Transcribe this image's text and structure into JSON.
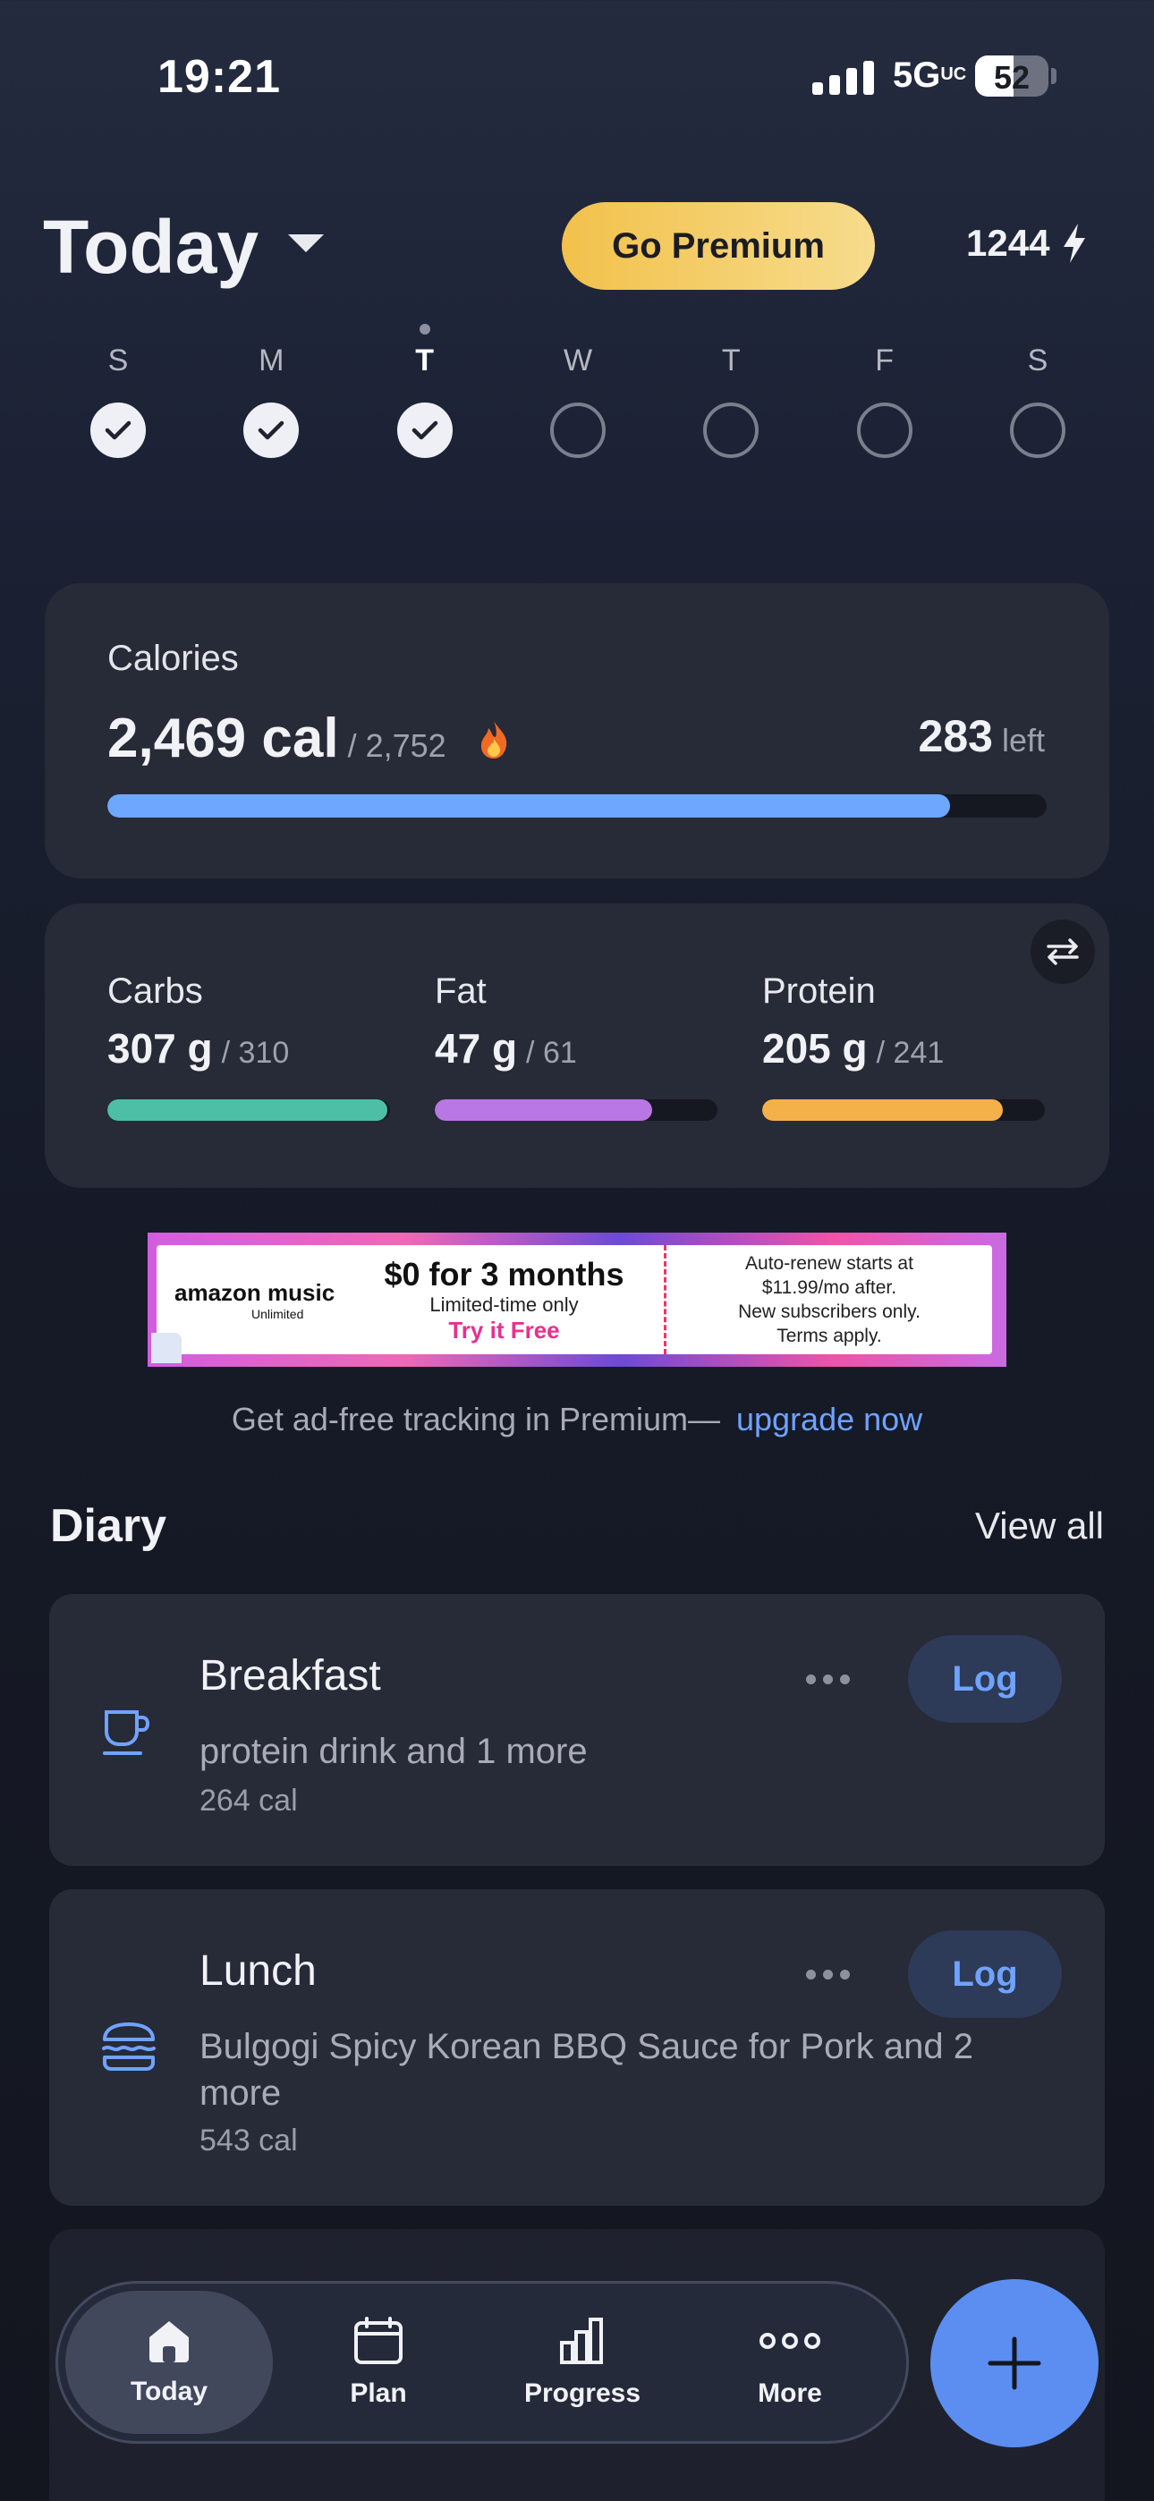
{
  "status_bar": {
    "time": "19:21",
    "network": "5G",
    "network_suffix": "UC",
    "battery": "52",
    "battery_level": 0.52
  },
  "header": {
    "title": "Today",
    "premium_label": "Go Premium",
    "streak_count": "1244"
  },
  "week": [
    {
      "label": "S",
      "done": true,
      "today": false
    },
    {
      "label": "M",
      "done": true,
      "today": false
    },
    {
      "label": "T",
      "done": true,
      "today": true
    },
    {
      "label": "W",
      "done": false,
      "today": false
    },
    {
      "label": "T",
      "done": false,
      "today": false
    },
    {
      "label": "F",
      "done": false,
      "today": false
    },
    {
      "label": "S",
      "done": false,
      "today": false
    }
  ],
  "calories": {
    "label": "Calories",
    "consumed": "2,469 cal",
    "goal": "/ 2,752",
    "left_value": "283",
    "left_label": "left",
    "progress": 0.897,
    "bar_color": "#6ea8fe"
  },
  "macros": [
    {
      "name": "Carbs",
      "value": "307 g",
      "goal": "/ 310",
      "progress": 0.99,
      "color": "#4cbfa6"
    },
    {
      "name": "Fat",
      "value": "47 g",
      "goal": "/ 61",
      "progress": 0.77,
      "color": "#b977e3"
    },
    {
      "name": "Protein",
      "value": "205 g",
      "goal": "/ 241",
      "progress": 0.85,
      "color": "#f4b14a"
    }
  ],
  "ad": {
    "brand": "amazon music",
    "brand_sub": "Unlimited",
    "offer": "$0 for 3 months",
    "limited": "Limited-time only",
    "cta": "Try it Free",
    "terms": "Auto-renew starts at\n$11.99/mo after.\nNew subscribers only.\nTerms apply."
  },
  "promo": {
    "text": "Get ad-free tracking in Premium—",
    "link": "upgrade now"
  },
  "diary": {
    "title": "Diary",
    "view_all": "View all",
    "log_label": "Log",
    "meals": [
      {
        "name": "Breakfast",
        "description": "protein drink and 1 more",
        "calories": "264 cal",
        "icon": "coffee-cup-icon"
      },
      {
        "name": "Lunch",
        "description": "Bulgogi Spicy Korean BBQ Sauce for Pork and 2 more",
        "calories": "543 cal",
        "icon": "burger-icon"
      }
    ]
  },
  "nav": {
    "tabs": [
      {
        "label": "Today",
        "icon": "home-icon",
        "active": true
      },
      {
        "label": "Plan",
        "icon": "calendar-icon",
        "active": false
      },
      {
        "label": "Progress",
        "icon": "bar-chart-icon",
        "active": false
      },
      {
        "label": "More",
        "icon": "more-dots-icon",
        "active": false
      }
    ],
    "fab_icon": "plus-icon"
  }
}
